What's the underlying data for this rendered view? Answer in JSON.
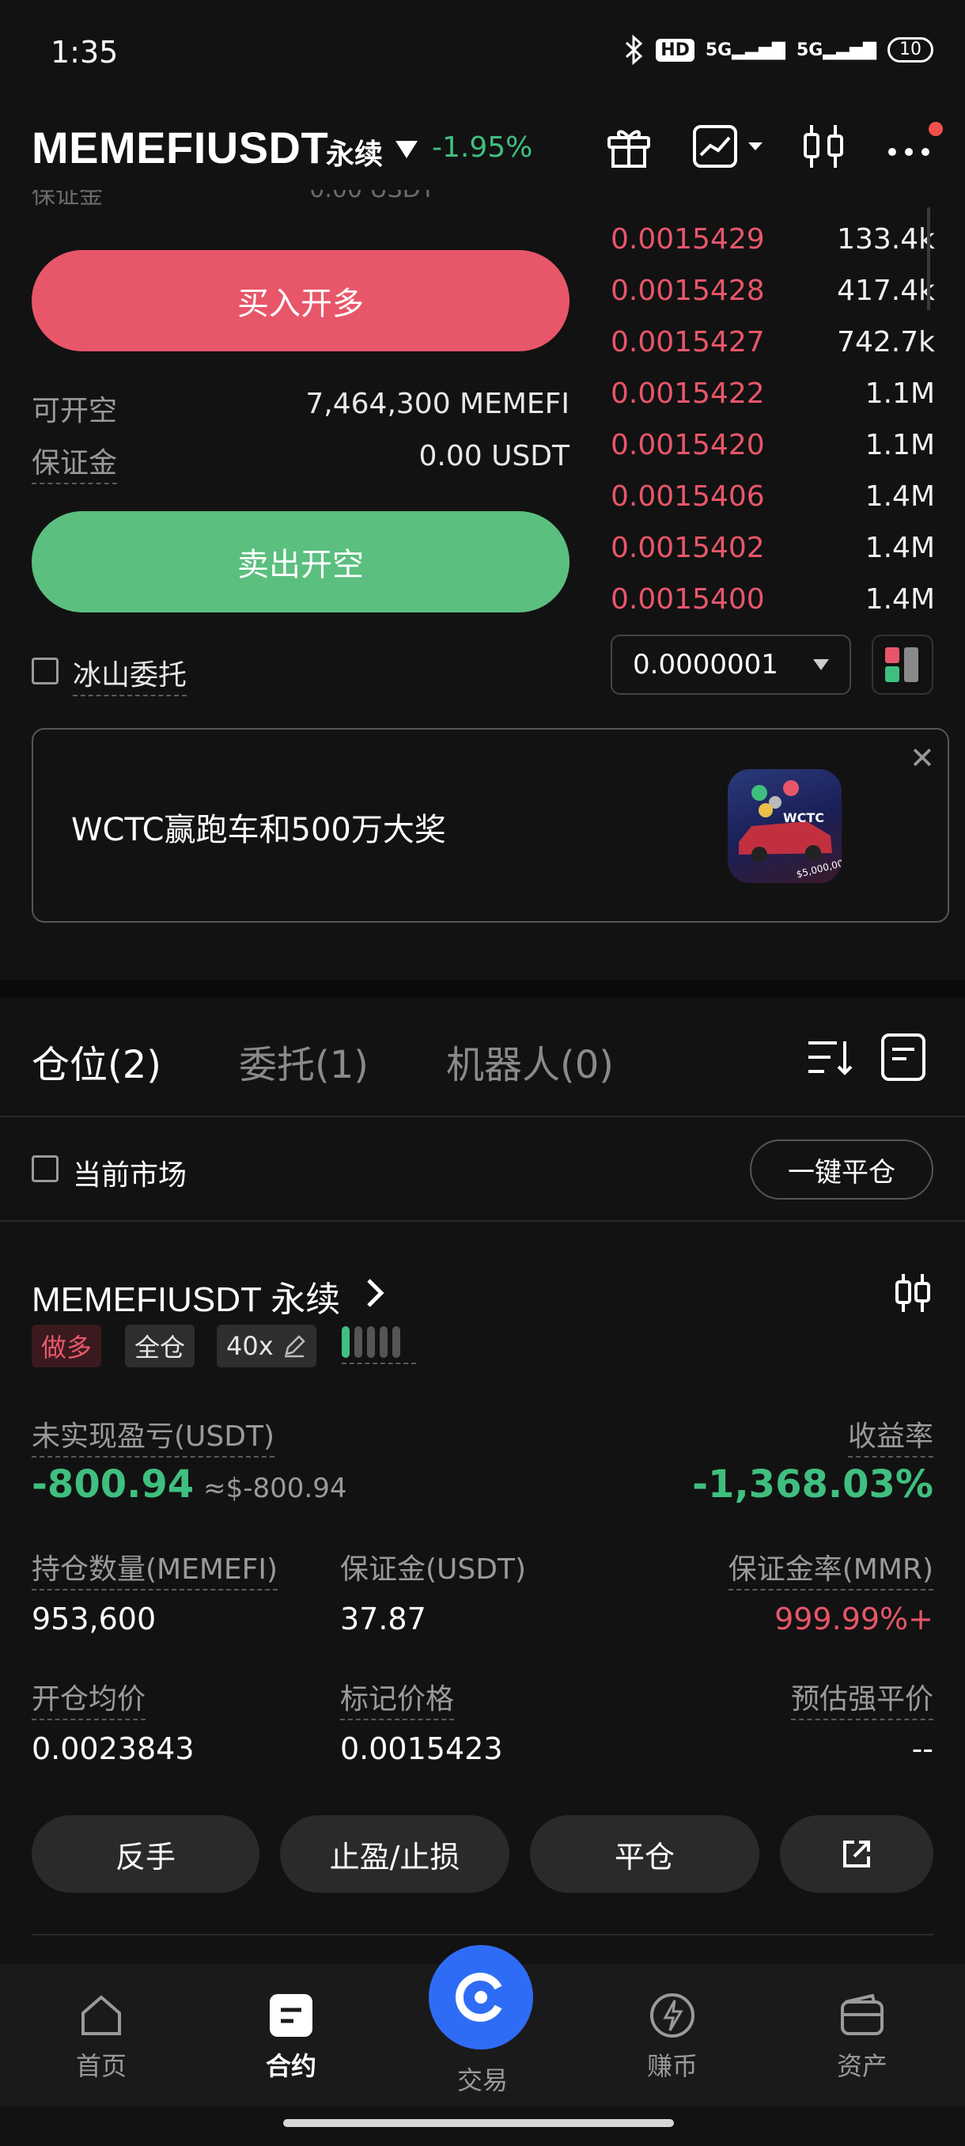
{
  "status_bar": {
    "time": "1:35",
    "hd_label": "HD",
    "signal_1": "5G",
    "signal_2": "5G",
    "battery": "10"
  },
  "header": {
    "symbol": "MEMEFIUSDT",
    "contract_type": "永续",
    "change": "-1.95%"
  },
  "order_form": {
    "buy_button": "买入开多",
    "sell_button": "卖出开空",
    "available_short_label": "可开空",
    "available_short_value": "7,464,300 MEMEFI",
    "margin_label": "保证金",
    "margin_value": "0.00 USDT",
    "iceberg_label": "冰山委托"
  },
  "order_book": {
    "asks": [
      {
        "price": "0.0015429",
        "qty": "133.4k"
      },
      {
        "price": "0.0015428",
        "qty": "417.4k"
      },
      {
        "price": "0.0015427",
        "qty": "742.7k"
      },
      {
        "price": "0.0015422",
        "qty": "1.1M"
      },
      {
        "price": "0.0015420",
        "qty": "1.1M"
      },
      {
        "price": "0.0015406",
        "qty": "1.4M"
      },
      {
        "price": "0.0015402",
        "qty": "1.4M"
      },
      {
        "price": "0.0015400",
        "qty": "1.4M"
      }
    ],
    "precision": "0.0000001"
  },
  "banner": {
    "text": "WCTC赢跑车和500万大奖",
    "badge_text": "WCTC",
    "prize_text": "$5,000,000"
  },
  "tabs": {
    "positions": "仓位(2)",
    "orders": "委托(1)",
    "bots": "机器人(0)"
  },
  "filter": {
    "current_market": "当前市场",
    "close_all": "一键平仓"
  },
  "position": {
    "title": "MEMEFIUSDT 永续",
    "side_tag": "做多",
    "margin_mode_tag": "全仓",
    "leverage_tag": "40x",
    "leverage_level": 0.2,
    "unrealized_pnl_label": "未实现盈亏(USDT)",
    "unrealized_pnl": "-800.94",
    "unrealized_pnl_usd": "≈$-800.94",
    "roe_label": "收益率",
    "roe": "-1,368.03%",
    "size_label": "持仓数量(MEMEFI)",
    "size": "953,600",
    "margin_label": "保证金(USDT)",
    "margin": "37.87",
    "mmr_label": "保证金率(MMR)",
    "mmr": "999.99%+",
    "entry_label": "开仓均价",
    "entry": "0.0023843",
    "mark_label": "标记价格",
    "mark": "0.0015423",
    "liq_label": "预估强平价",
    "liq": "--"
  },
  "actions": {
    "reverse": "反手",
    "tpsl": "止盈/止损",
    "close": "平仓"
  },
  "bottom_nav": {
    "home": "首页",
    "futures": "合约",
    "trade": "交易",
    "earn": "赚币",
    "assets": "资产"
  },
  "colors": {
    "red": "#e8566a",
    "green": "#3fbf7f",
    "blue": "#2f6cf6"
  }
}
